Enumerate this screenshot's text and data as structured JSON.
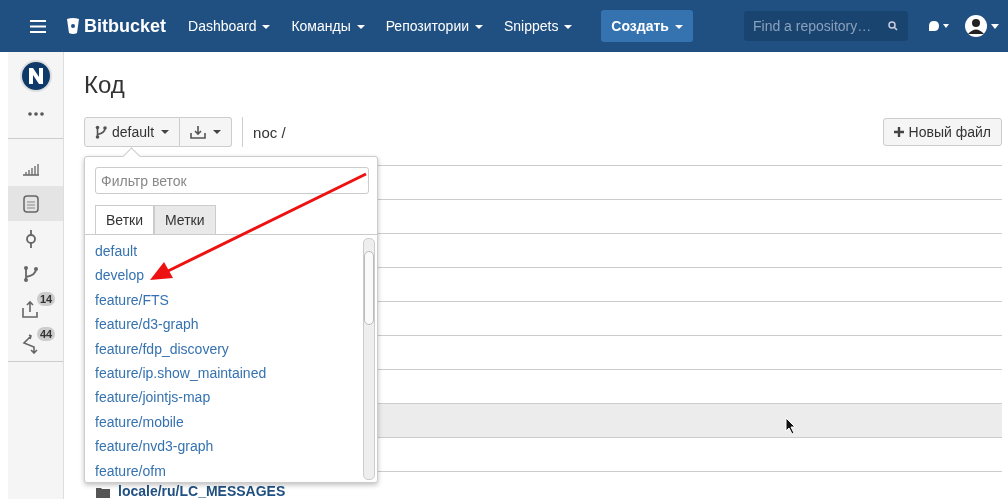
{
  "header": {
    "logo": "Bitbucket",
    "nav": [
      {
        "label": "Dashboard"
      },
      {
        "label": "Команды"
      },
      {
        "label": "Репозитории"
      },
      {
        "label": "Snippets"
      }
    ],
    "create_button": "Создать",
    "search": {
      "placeholder": "Find a repository…"
    }
  },
  "sidebar": {
    "items": [
      {
        "kind": "overview",
        "selected": false
      },
      {
        "kind": "source",
        "selected": true
      },
      {
        "kind": "commits",
        "selected": false
      },
      {
        "kind": "branches",
        "selected": false
      },
      {
        "kind": "pull-requests",
        "selected": false,
        "badge": "14"
      },
      {
        "kind": "forks",
        "selected": false,
        "badge": "44"
      }
    ]
  },
  "page_title": "Код",
  "branch_button": "default",
  "breadcrumb": "noc /",
  "new_file_button": "Новый файл",
  "file_rows": [
    {
      "highlighted": false
    },
    {
      "highlighted": false
    },
    {
      "highlighted": false
    },
    {
      "highlighted": false
    },
    {
      "highlighted": false
    },
    {
      "highlighted": false
    },
    {
      "highlighted": false
    },
    {
      "highlighted": true
    },
    {
      "highlighted": false
    },
    {
      "highlighted": false,
      "kind": "folder",
      "name": "locale/ru/LC_MESSAGES"
    }
  ],
  "branch_dropdown": {
    "filter_placeholder": "Фильтр веток",
    "tabs": [
      {
        "label": "Ветки",
        "selected": true
      },
      {
        "label": "Метки",
        "selected": false
      }
    ],
    "branches": [
      "default",
      "develop",
      "feature/FTS",
      "feature/d3-graph",
      "feature/fdp_discovery",
      "feature/ip.show_maintained",
      "feature/jointjs-map",
      "feature/mobile",
      "feature/nvd3-graph",
      "feature/ofm"
    ]
  }
}
